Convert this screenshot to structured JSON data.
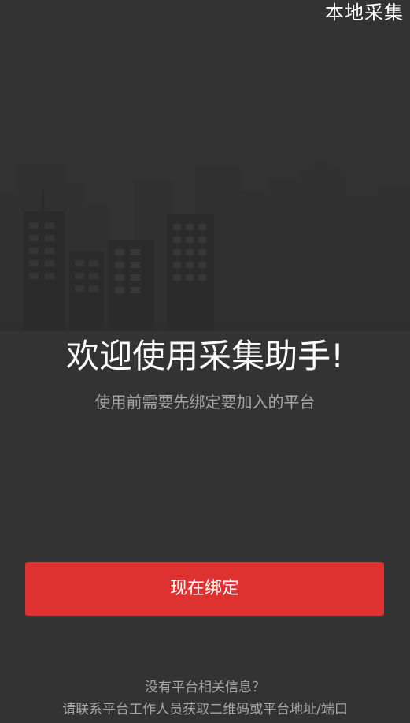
{
  "header": {
    "local_collect_label": "本地采集"
  },
  "welcome": {
    "title": "欢迎使用采集助手!",
    "subtitle": "使用前需要先绑定要加入的平台"
  },
  "actions": {
    "bind_now_label": "现在绑定"
  },
  "footer": {
    "question": "没有平台相关信息？",
    "contact": "请联系平台工作人员获取二维码或平台地址/端口"
  },
  "colors": {
    "background": "#333333",
    "primary_button": "#e03131",
    "secondary_text": "#a6a6a6",
    "illustration_dark": "#2b2b2b",
    "illustration_far": "#303030"
  },
  "icons": {
    "illustration": "city-skyline-illustration"
  }
}
